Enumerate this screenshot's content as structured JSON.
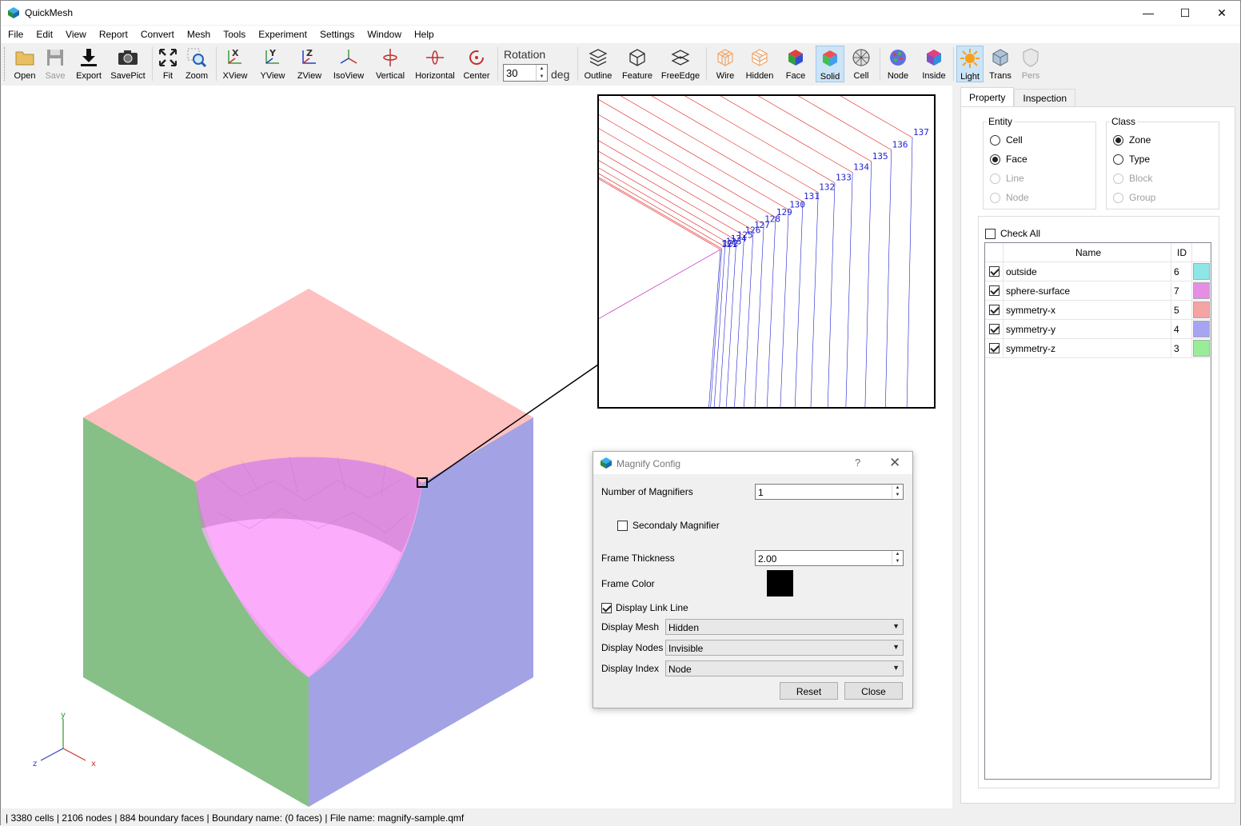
{
  "app": {
    "title": "QuickMesh",
    "icon": "quickmesh-cube-icon"
  },
  "window_controls": {
    "minimize": "—",
    "maximize": "☐",
    "close": "✕"
  },
  "menu": [
    "File",
    "Edit",
    "View",
    "Report",
    "Convert",
    "Mesh",
    "Tools",
    "Experiment",
    "Settings",
    "Window",
    "Help"
  ],
  "toolbar": {
    "open": "Open",
    "save": "Save",
    "export": "Export",
    "savepict": "SavePict",
    "fit": "Fit",
    "zoom": "Zoom",
    "xview": "XView",
    "yview": "YView",
    "zview": "ZView",
    "isoview": "IsoView",
    "vertical": "Vertical",
    "horizontal": "Horizontal",
    "center": "Center",
    "rotation_label": "Rotation",
    "rotation_value": "30",
    "rotation_unit": "deg",
    "outline": "Outline",
    "feature": "Feature",
    "freeedge": "FreeEdge",
    "wire": "Wire",
    "hidden": "Hidden",
    "face": "Face",
    "solid": "Solid",
    "cell": "Cell",
    "node": "Node",
    "inside": "Inside",
    "light": "Light",
    "trans": "Trans",
    "pers": "Pers"
  },
  "viewport": {
    "axis_x": "x",
    "axis_y": "y",
    "axis_z": "z",
    "colors": {
      "top_face": "#ffc0c0",
      "left_face": "#86c087",
      "right_face": "#a2a2e4",
      "sphere": "#f0a0f0",
      "edge_red": "#e02020",
      "edge_blue": "#2020d0"
    },
    "magnifier_labels": [
      "137",
      "136",
      "135",
      "134",
      "133",
      "132",
      "131",
      "130",
      "129",
      "128",
      "127",
      "126",
      "125",
      "124",
      "123",
      "122",
      "121"
    ]
  },
  "panel": {
    "tabs": [
      "Property",
      "Inspection"
    ],
    "entity_title": "Entity",
    "entity_options": [
      "Cell",
      "Face",
      "Line",
      "Node"
    ],
    "class_title": "Class",
    "class_options": [
      "Zone",
      "Type",
      "Block",
      "Group"
    ],
    "check_all": "Check All",
    "table_headers": {
      "name": "Name",
      "id": "ID"
    },
    "zones": [
      {
        "name": "outside",
        "id": "6",
        "color": "#8ee6e6"
      },
      {
        "name": "sphere-surface",
        "id": "7",
        "color": "#e48ee6"
      },
      {
        "name": "symmetry-x",
        "id": "5",
        "color": "#f5a3a3"
      },
      {
        "name": "symmetry-y",
        "id": "4",
        "color": "#a5a5f2"
      },
      {
        "name": "symmetry-z",
        "id": "3",
        "color": "#98ee98"
      }
    ]
  },
  "dialog": {
    "title": "Magnify Config",
    "help": "?",
    "close": "✕",
    "num_magnifiers_label": "Number of Magnifiers",
    "num_magnifiers_value": "1",
    "secondary_label": "Secondaly Magnifier",
    "frame_thickness_label": "Frame Thickness",
    "frame_thickness_value": "2.00",
    "frame_color_label": "Frame Color",
    "frame_color": "#000000",
    "display_link_label": "Display Link Line",
    "display_mesh_label": "Display Mesh",
    "display_mesh_value": "Hidden",
    "display_nodes_label": "Display Nodes",
    "display_nodes_value": "Invisible",
    "display_index_label": "Display Index",
    "display_index_value": "Node",
    "reset": "Reset",
    "close_btn": "Close"
  },
  "status": "| 3380 cells | 2106 nodes | 884 boundary faces |  Boundary name:  (0 faces) | File name: magnify-sample.qmf"
}
